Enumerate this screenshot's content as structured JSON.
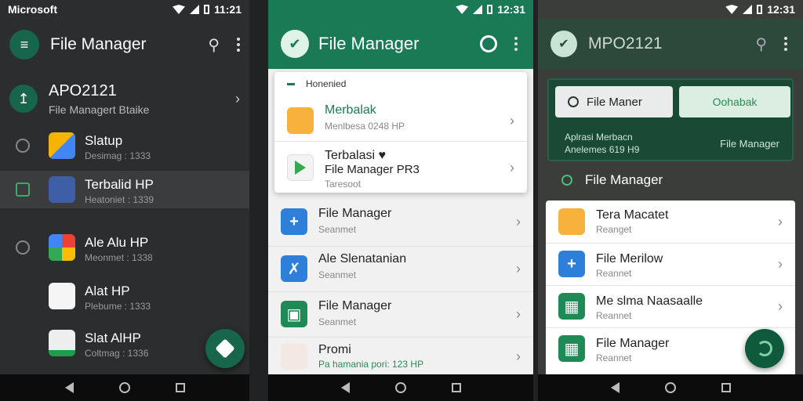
{
  "panel1": {
    "status": {
      "left": "Microsoft",
      "time": "11:21"
    },
    "appbar": {
      "title": "File Manager",
      "logo_icon": "menu-lines-icon"
    },
    "account": {
      "name": "APO2121",
      "subtitle": "File Managert Btaike",
      "icon": "pin-icon"
    },
    "items": [
      {
        "title": "Slatup",
        "subtitle": "Desimag : 1333"
      },
      {
        "title": "Terbalid HP",
        "subtitle": "Heatoniet : 1339"
      },
      {
        "title": "Ale Alu HP",
        "subtitle": "Meonmet : 1338"
      },
      {
        "title": "Alat HP",
        "subtitle": "Plebume : 1333"
      },
      {
        "title": "Slat AlHP",
        "subtitle": "Coltmag : 1336"
      }
    ],
    "fab_icon": "diamond-icon"
  },
  "panel2": {
    "status": {
      "time": "12:31"
    },
    "appbar": {
      "title": "File Manager"
    },
    "card_header": "Honenied",
    "rows": [
      {
        "title": "Merbalak",
        "subtitle": "Menlbesa 0248 HP"
      },
      {
        "title": "Terbalasi ♥",
        "subtitle": "File Manager PR3",
        "extra": "Taresoot"
      },
      {
        "title": "File Manager",
        "subtitle": "Seanmet"
      },
      {
        "title": "Ale Slenatanian",
        "subtitle": "Seanmet"
      },
      {
        "title": "File Manager",
        "subtitle": "Seanmet"
      },
      {
        "title": "Promi",
        "subtitle": "Pa hamania pori: 123 HP"
      }
    ]
  },
  "panel3": {
    "status": {
      "time": "12:31"
    },
    "appbar": {
      "title": "MPO2121"
    },
    "banner": {
      "search_label": "File Maner",
      "ok_label": "Oohabak",
      "line1": "Aplrasi Merbacn",
      "line2": "Anelemes 619 H9",
      "right_label": "File Manager"
    },
    "section_title": "File Manager",
    "rows": [
      {
        "title": "Tera Macatet",
        "subtitle": "Reanget"
      },
      {
        "title": "File Merilow",
        "subtitle": "Reannet"
      },
      {
        "title": "Me slma Naasaalle",
        "subtitle": "Reannet"
      },
      {
        "title": "File Manager",
        "subtitle": "Reannet"
      }
    ],
    "fab_icon": "sync-icon"
  },
  "colors": {
    "brand_green": "#1a7a56",
    "dark_green": "#17654a",
    "drawer_bg": "#2b2d2f"
  }
}
